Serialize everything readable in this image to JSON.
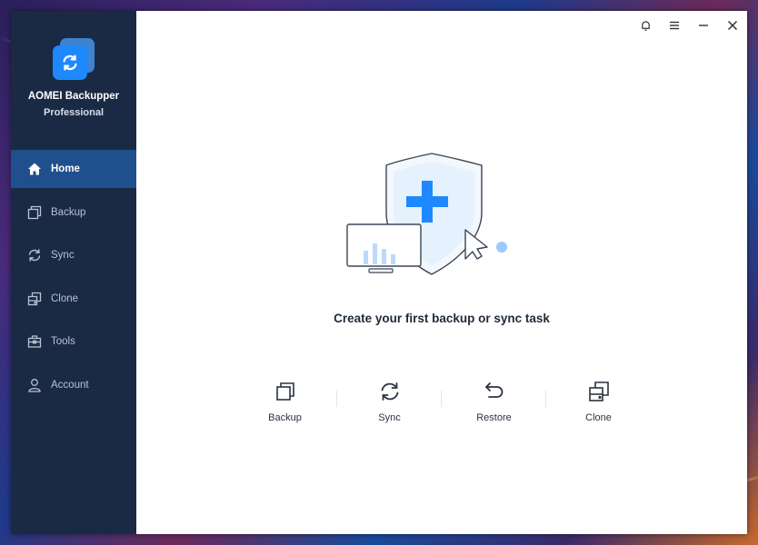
{
  "app": {
    "name": "AOMEI Backupper",
    "edition": "Professional",
    "logo_icon": "sync-logo-icon"
  },
  "colors": {
    "sidebar_bg": "#1b2a44",
    "sidebar_active": "#1f4f8c",
    "accent": "#1e88ff"
  },
  "sidebar": {
    "items": [
      {
        "label": "Home",
        "icon": "home-icon",
        "active": true
      },
      {
        "label": "Backup",
        "icon": "backup-icon",
        "active": false
      },
      {
        "label": "Sync",
        "icon": "sync-icon",
        "active": false
      },
      {
        "label": "Clone",
        "icon": "clone-icon",
        "active": false
      },
      {
        "label": "Tools",
        "icon": "toolbox-icon",
        "active": false
      },
      {
        "label": "Account",
        "icon": "user-icon",
        "active": false
      }
    ]
  },
  "titlebar": {
    "buttons": [
      "bell-icon",
      "menu-icon",
      "minimize-icon",
      "close-icon"
    ]
  },
  "main": {
    "headline": "Create your first backup or sync task",
    "actions": [
      {
        "label": "Backup",
        "icon": "backup-icon"
      },
      {
        "label": "Sync",
        "icon": "sync-icon"
      },
      {
        "label": "Restore",
        "icon": "restore-icon"
      },
      {
        "label": "Clone",
        "icon": "clone-icon"
      }
    ]
  }
}
